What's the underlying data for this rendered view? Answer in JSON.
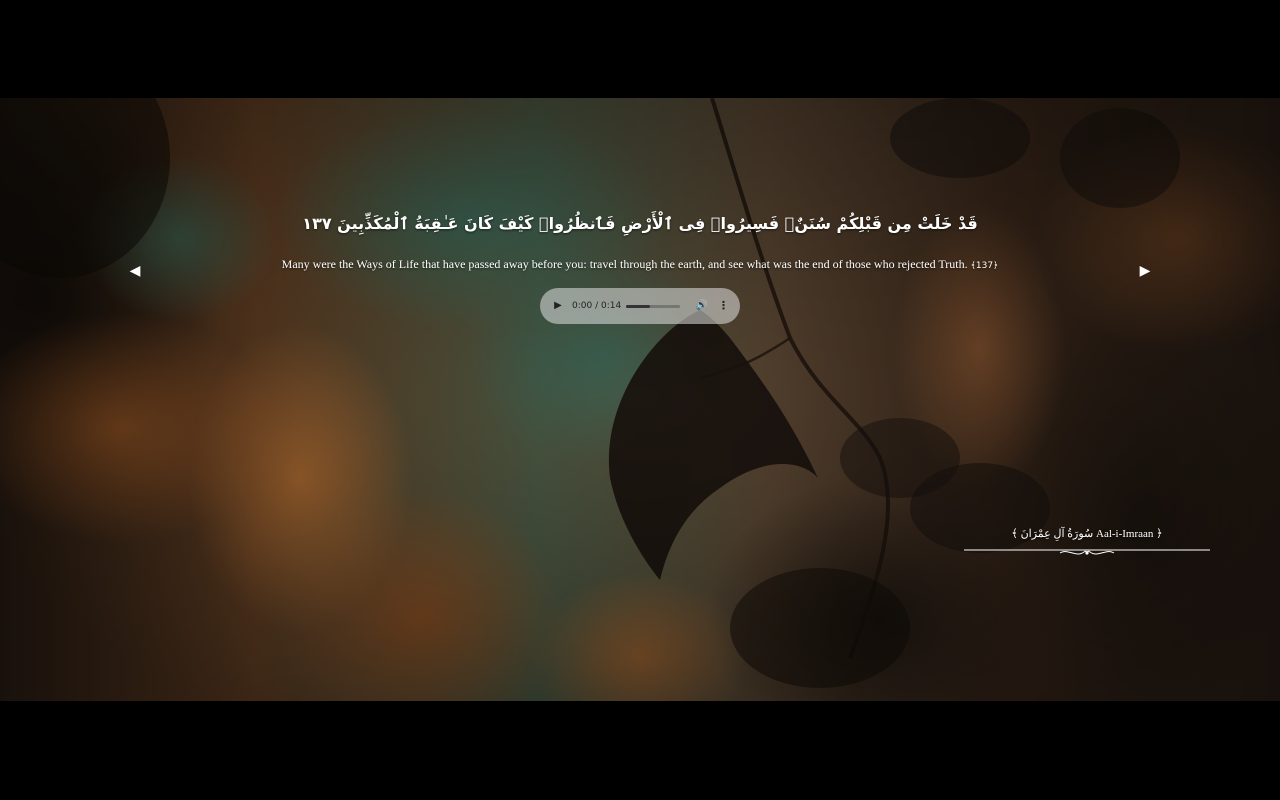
{
  "verse": {
    "arabic": "قَدْ خَلَتْ مِن قَبْلِكُمْ سُنَنٌۭ فَسِيرُوا۟ فِى ٱلْأَرْضِ فَٱنظُرُوا۟ كَيْفَ كَانَ عَـٰقِبَةُ ٱلْمُكَذِّبِينَ ١٣٧",
    "translation": "Many were the Ways of Life that have passed away before you: travel through the earth, and see what was the end of those who rejected Truth.",
    "number_marker": "﴾137﴿"
  },
  "navigation": {
    "prev_icon": "triangle-left-icon",
    "prev_glyph": "◀",
    "next_icon": "triangle-right-icon",
    "next_glyph": "▶"
  },
  "audio": {
    "play_glyph": "▶",
    "time": "0:00 / 0:14",
    "progress": 0.45,
    "volume_glyph": "🔊",
    "more_glyph": "⋮"
  },
  "surah": {
    "label": "﴾ سُورَةُ آلِ عِمْرَانَ Aal-i-Imraan ﴿"
  },
  "colors": {
    "text": "#ffffff",
    "letterbox": "#000000",
    "player_bg": "rgba(225,225,225,0.55)"
  }
}
